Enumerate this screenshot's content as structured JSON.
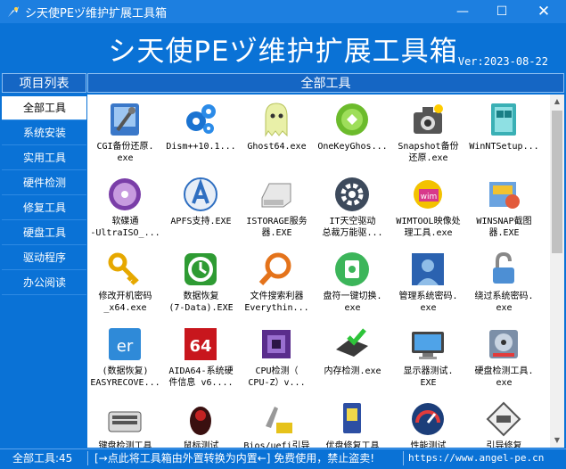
{
  "window": {
    "title": "シ天使PEヅ维护扩展工具箱",
    "min": "—",
    "max": "☐",
    "close": "✕"
  },
  "banner": {
    "title": "シ天使PEヅ维护扩展工具箱",
    "version": "Ver:2023-08-22"
  },
  "sidebar": {
    "header": "项目列表",
    "items": [
      {
        "label": "全部工具",
        "active": true
      },
      {
        "label": "系统安装"
      },
      {
        "label": "实用工具"
      },
      {
        "label": "硬件检测"
      },
      {
        "label": "修复工具"
      },
      {
        "label": "硬盘工具"
      },
      {
        "label": "驱动程序"
      },
      {
        "label": "办公阅读"
      }
    ]
  },
  "content": {
    "header": "全部工具"
  },
  "tools": [
    {
      "l1": "CGI备份还原.",
      "l2": "exe",
      "icon": "cgi-icon"
    },
    {
      "l1": "Dism++10.1...",
      "l2": "",
      "icon": "dism-icon"
    },
    {
      "l1": "Ghost64.exe",
      "l2": "",
      "icon": "ghost-icon"
    },
    {
      "l1": "OneKeyGhos...",
      "l2": "",
      "icon": "onekey-ghost-icon"
    },
    {
      "l1": "Snapshot备份",
      "l2": "还原.exe",
      "icon": "snapshot-icon"
    },
    {
      "l1": "WinNTSetup...",
      "l2": "",
      "icon": "winntsetup-icon"
    },
    {
      "l1": "软碟通",
      "l2": "-UltraISO_...",
      "icon": "ultraiso-icon"
    },
    {
      "l1": "APFS支持.EXE",
      "l2": "",
      "icon": "apfs-icon"
    },
    {
      "l1": "ISTORAGE服务",
      "l2": "器.EXE",
      "icon": "istorage-icon"
    },
    {
      "l1": "IT天空驱动",
      "l2": "总裁万能驱...",
      "icon": "driver-gear-icon"
    },
    {
      "l1": "WIMTOOL映像处",
      "l2": "理工具.exe",
      "icon": "wimtool-icon"
    },
    {
      "l1": "WINSNAP截图",
      "l2": "器.EXE",
      "icon": "winsnap-icon"
    },
    {
      "l1": "修改开机密码",
      "l2": "_x64.exe",
      "icon": "key-icon"
    },
    {
      "l1": "数据恢复",
      "l2": "(7-Data).EXE",
      "icon": "data-recovery-icon"
    },
    {
      "l1": "文件搜索利器",
      "l2": "Everythin...",
      "icon": "everything-search-icon"
    },
    {
      "l1": "盘符一键切换.",
      "l2": "exe",
      "icon": "drive-letter-icon"
    },
    {
      "l1": "管理系统密码.",
      "l2": "exe",
      "icon": "user-password-icon"
    },
    {
      "l1": "绕过系统密码.",
      "l2": "exe",
      "icon": "bypass-password-icon"
    },
    {
      "l1": "(数据恢复)",
      "l2": "EASYRECOVE...",
      "icon": "easyrecovery-icon"
    },
    {
      "l1": "AIDA64-系统硬",
      "l2": "件信息 v6....",
      "icon": "aida64-icon"
    },
    {
      "l1": "CPU检测（",
      "l2": "CPU-Z）v...",
      "icon": "cpuz-icon"
    },
    {
      "l1": "内存检测.exe",
      "l2": "",
      "icon": "memory-test-icon"
    },
    {
      "l1": "显示器测试.",
      "l2": "EXE",
      "icon": "monitor-test-icon"
    },
    {
      "l1": "硬盘检测工具.",
      "l2": "exe",
      "icon": "disk-check-icon"
    },
    {
      "l1": "键盘检测工具",
      "l2": "",
      "icon": "keyboard-icon"
    },
    {
      "l1": "鼠标测试",
      "l2": "",
      "icon": "mouse-icon"
    },
    {
      "l1": "Bios/uefi引导",
      "l2": "",
      "icon": "bios-icon"
    },
    {
      "l1": "优盘修复工具",
      "l2": "",
      "icon": "usb-repair-icon"
    },
    {
      "l1": "性能测试",
      "l2": "",
      "icon": "benchmark-icon"
    },
    {
      "l1": "引导修复",
      "l2": "",
      "icon": "boot-repair-icon"
    }
  ],
  "statusbar": {
    "count": "全部工具:45",
    "hint": "[→点此将工具箱由外置转换为内置←] 免费使用，禁止盗卖!",
    "url": "https://www.angel-pe.cn"
  }
}
